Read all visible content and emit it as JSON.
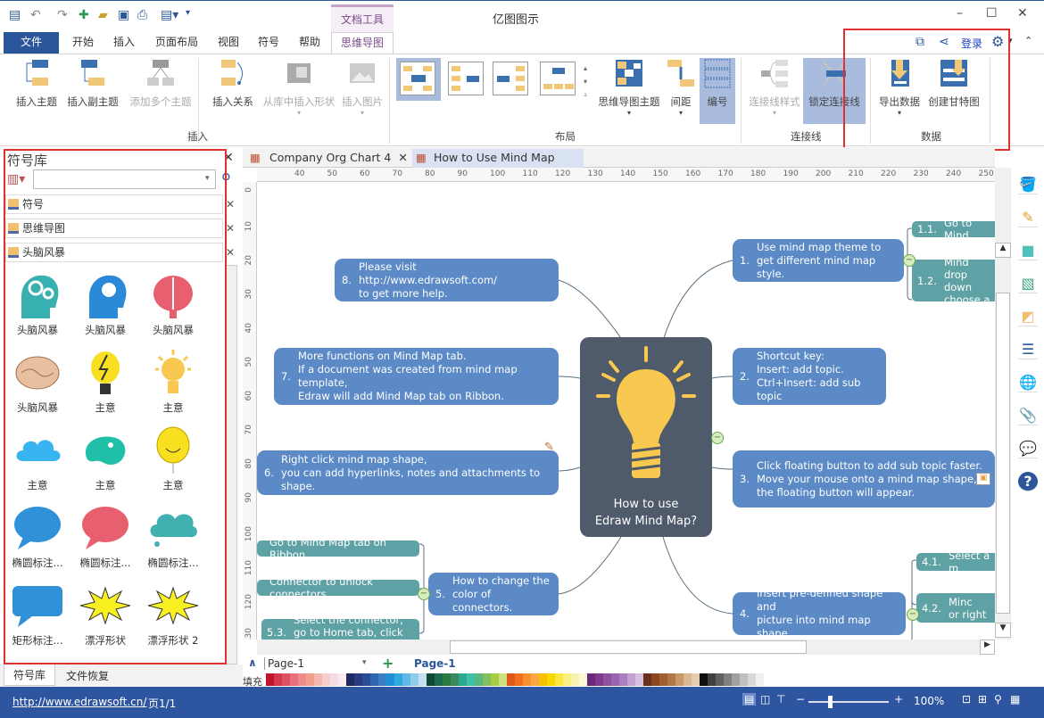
{
  "titlebar": {
    "title": "亿图图示",
    "context_tab": "文档工具",
    "quick_access": [
      "app-logo-icon",
      "undo-icon",
      "redo-icon",
      "new-icon",
      "open-icon",
      "save-icon",
      "print-icon",
      "export-icon",
      "customize-icon"
    ],
    "minimize": "–",
    "maximize": "☐",
    "close": "✕"
  },
  "tabs": {
    "file": "文件",
    "items": [
      "开始",
      "插入",
      "页面布局",
      "视图",
      "符号",
      "帮助"
    ],
    "mindmap": "思维导图",
    "login": "登录"
  },
  "ribbon": {
    "insert": {
      "group": "插入",
      "buttons": [
        "插入主题",
        "插入副主题",
        "添加多个主题",
        "插入关系",
        "从库中插入形状",
        "插入图片"
      ]
    },
    "layout": {
      "group": "布局",
      "buttons": [
        "思维导图主题",
        "间距",
        "编号"
      ]
    },
    "connector": {
      "group": "连接线",
      "buttons": [
        "连接线样式",
        "锁定连接线"
      ]
    },
    "data": {
      "group": "数据",
      "buttons": [
        "导出数据",
        "创建甘特图"
      ]
    }
  },
  "library": {
    "title": "符号库",
    "search_value": "",
    "categories": [
      "符号",
      "思维导图",
      "头脑风暴"
    ],
    "symbols": [
      {
        "label": "头脑风暴",
        "icon": "gear-head-icon"
      },
      {
        "label": "头脑风暴",
        "icon": "bulb-head-icon"
      },
      {
        "label": "头脑风暴",
        "icon": "brain-red-icon"
      },
      {
        "label": "头脑风暴",
        "icon": "brain-icon"
      },
      {
        "label": "主意",
        "icon": "lightning-bulb-icon"
      },
      {
        "label": "主意",
        "icon": "lightbulb-icon"
      },
      {
        "label": "主意",
        "icon": "cloud-icon"
      },
      {
        "label": "主意",
        "icon": "blob-icon"
      },
      {
        "label": "主意",
        "icon": "balloon-face-icon"
      },
      {
        "label": "椭圆标注...",
        "icon": "oval-callout-icon"
      },
      {
        "label": "椭圆标注...",
        "icon": "oval-callout-icon"
      },
      {
        "label": "椭圆标注...",
        "icon": "cloud-callout-icon"
      },
      {
        "label": "矩形标注...",
        "icon": "rect-callout-icon"
      },
      {
        "label": "漂浮形状",
        "icon": "burst-icon"
      },
      {
        "label": "漂浮形状 2",
        "icon": "burst-icon"
      }
    ],
    "bottom_tabs": [
      "符号库",
      "文件恢复"
    ]
  },
  "doc_tabs": [
    "Company Org Chart 4",
    "How to Use Mind Map"
  ],
  "rulers": {
    "top": [
      "40",
      "50",
      "60",
      "70",
      "80",
      "90",
      "100",
      "110",
      "120",
      "130",
      "140",
      "150",
      "160",
      "170",
      "180",
      "190",
      "200",
      "210",
      "220",
      "230",
      "240",
      "250"
    ],
    "left": [
      "0",
      "10",
      "20",
      "30",
      "40",
      "50",
      "60",
      "70",
      "80",
      "90",
      "100",
      "110",
      "120",
      "130"
    ]
  },
  "mindmap": {
    "center": "How to use\nEdraw Mind Map?",
    "nodes": [
      {
        "n": "1.",
        "text": "Use mind map theme to\nget different mind map style."
      },
      {
        "n": "2.",
        "text": "Shortcut key:\nInsert: add topic.\nCtrl+Insert: add sub topic"
      },
      {
        "n": "3.",
        "text": "Click floating button to add sub topic faster.\nMove your mouse onto a mind map shape,\nthe floating button will appear."
      },
      {
        "n": "4.",
        "text": "Insert pre-defined shape and\npicture into mind map shape."
      },
      {
        "n": "5.",
        "text": "How to change the\ncolor of connectors."
      },
      {
        "n": "6.",
        "text": "Right click mind map shape,\nyou can add hyperlinks, notes and attachments to shape."
      },
      {
        "n": "7.",
        "text": "More functions on Mind Map tab.\nIf a document was created from mind map template,\nEdraw will add Mind Map tab on Ribbon."
      },
      {
        "n": "8.",
        "text": "Please visit http://www.edrawsoft.com/\nto get more help."
      }
    ],
    "subs": [
      {
        "n": "1.1.",
        "text": "Go to Mind"
      },
      {
        "n": "1.2.",
        "text": "Click Mind\ndrop down\nchoose a m"
      },
      {
        "n": "4.1.",
        "text": "Select a m"
      },
      {
        "n": "4.2.",
        "text": "Go to Minc\nor right clic"
      },
      {
        "n": "",
        "text": "Go to Mind Map tab on Ribbon"
      },
      {
        "n": "",
        "text": "Connector to unlock connectors"
      },
      {
        "n": "5.3.",
        "text": "Select the connector,\ngo to Home tab, click Line"
      }
    ]
  },
  "right_toolbar": [
    "fill-icon",
    "line-icon",
    "shape-icon",
    "image-icon",
    "layer-icon",
    "list-icon",
    "hyperlink-icon",
    "attachment-icon",
    "comment-icon",
    "help-icon"
  ],
  "pagebar": {
    "page_select": "Page-1",
    "active_page": "Page-1",
    "fill_label": "填充"
  },
  "palette": [
    "#c0142a",
    "#d4384c",
    "#e05064",
    "#e8707c",
    "#ee8a8a",
    "#f0a08c",
    "#f4b8b0",
    "#f6cccc",
    "#f4dce4",
    "#f8eaf0",
    "#1f2a60",
    "#283c80",
    "#2a4c98",
    "#2f66b0",
    "#3a7ec8",
    "#1e90d8",
    "#30a8e0",
    "#60b8e8",
    "#90cce8",
    "#c4e0f0",
    "#104838",
    "#1a6a50",
    "#2a7a40",
    "#3a8a60",
    "#2aa890",
    "#40c0a8",
    "#58b880",
    "#80c060",
    "#a8cc40",
    "#cce080",
    "#e05818",
    "#f07020",
    "#f89030",
    "#f8a840",
    "#f8c000",
    "#f8d800",
    "#f8e840",
    "#f8f080",
    "#f8f4b0",
    "#fcf8d8",
    "#6a2a78",
    "#803890",
    "#9050a0",
    "#9c64b0",
    "#a880c0",
    "#c4a0d0",
    "#d8c0e0",
    "#6a3018",
    "#8a4820",
    "#a06030",
    "#b07848",
    "#c89868",
    "#d8b890",
    "#e4ccb0",
    "#101010",
    "#404040",
    "#606060",
    "#808080",
    "#a0a0a0",
    "#c0c0c0",
    "#d8d8d8",
    "#f0f0f0"
  ],
  "statusbar": {
    "url": "http://www.edrawsoft.cn/",
    "page": "页1/1",
    "zoom": "100%",
    "zoom_level_percent": 100
  },
  "colors": {
    "accent": "#2b579a",
    "node": "#5b8ac6",
    "subnode": "#5fa2a5",
    "center": "#4f5a6b",
    "highlight": "#e03030"
  }
}
